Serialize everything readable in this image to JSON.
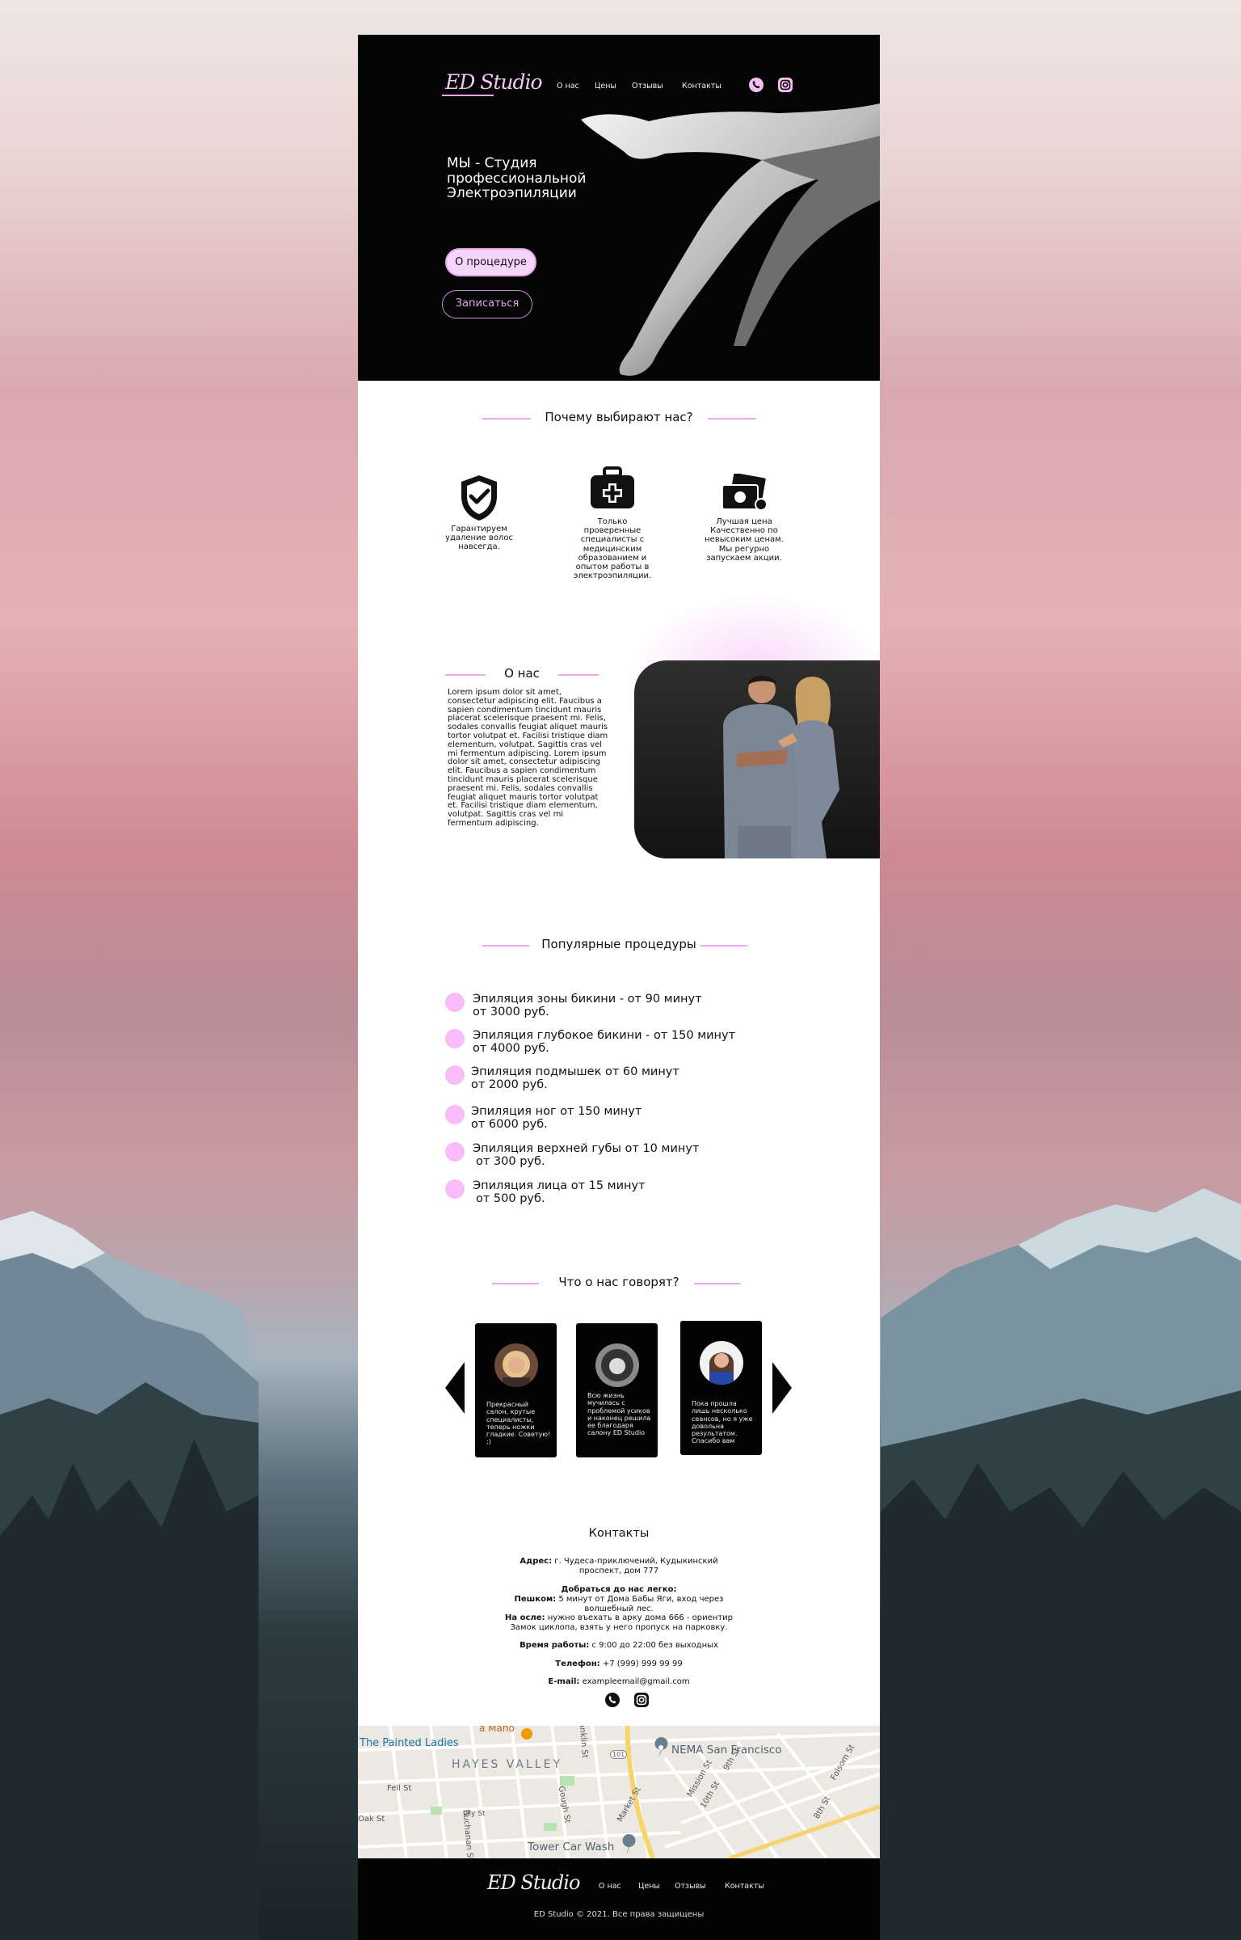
{
  "header": {
    "logo": "ED Studio",
    "nav": [
      "О нас",
      "Цены",
      "Отзывы",
      "Контакты"
    ],
    "social_icons": [
      "whatsapp-icon",
      "instagram-icon"
    ]
  },
  "hero": {
    "title_line1": "МЫ - Студия",
    "title_line2": "профессиональной",
    "title_line3": "Электроэпиляции",
    "btn_procedure": "О процедуре",
    "btn_signup": "Записаться"
  },
  "why": {
    "title": "Почему выбирают нас?",
    "items": [
      {
        "icon": "shield-check-icon",
        "text": "Гарантируем удаление волос навсегда."
      },
      {
        "icon": "medical-kit-icon",
        "text": "Только проверенные специалисты с медицинским образованием и опытом работы в электроэпиляции."
      },
      {
        "icon": "money-icon",
        "text": "Лучшая цена Качественно по невысоким ценам. Мы регурно запускаем акции."
      }
    ]
  },
  "about": {
    "title": "О нас",
    "text": "Lorem ipsum dolor sit amet, consectetur adipiscing elit. Faucibus a sapien condimentum tincidunt mauris placerat scelerisque praesent mi. Felis, sodales convallis feugiat aliquet mauris tortor volutpat et. Facilisi tristique diam elementum, volutpat. Sagittis cras vel mi fermentum adipiscing. Lorem ipsum dolor sit amet, consectetur adipiscing elit. Faucibus a sapien condimentum tincidunt mauris placerat scelerisque praesent mi. Felis, sodales convallis feugiat aliquet mauris tortor volutpat et. Facilisi tristique diam elementum, volutpat. Sagittis cras vel mi fermentum adipiscing."
  },
  "procedures": {
    "title": "Популярные процедуры",
    "items": [
      {
        "line1": "Эпиляция зоны бикини  - от 90 минут",
        "line2": "от 3000 руб."
      },
      {
        "line1": "Эпиляция глубокое бикини - от 150 минут",
        "line2": "от 4000 руб."
      },
      {
        "line1": "Эпиляция подмышек от 60 минут",
        "line2": "от 2000 руб."
      },
      {
        "line1": "Эпиляция ног от 150 минут",
        "line2": "от 6000 руб."
      },
      {
        "line1": "Эпиляция верхней губы от 10 минут",
        "line2": "от 300 руб."
      },
      {
        "line1": "Эпиляция лица от 15 минут",
        "line2": "от 500 руб."
      }
    ]
  },
  "reviews": {
    "title": "Что о нас говорят?",
    "items": [
      {
        "text": "Прекрасный салон, крутые специалисты, теперь ножки гладкие. Советую! ;)"
      },
      {
        "text": "Всю жизнь мучилась с проблемой усиков и наконец решила ее благодаря салону ED Studio"
      },
      {
        "text": "Пока прошла лишь несколько сеансов, но я уже довольна результатом. Спасибо вам"
      }
    ]
  },
  "contacts": {
    "title": "Контакты",
    "address_label": "Адрес:",
    "address_line1": "г. Чудеса-приключений, Кудыкинский",
    "address_line2": "проспект, дом 777",
    "route_label": "Добраться до нас легко:",
    "walk_label": "Пешком:",
    "walk_text": "5 минут от Дома Бабы Яги, вход через",
    "walk_text2": "волшебный лес.",
    "donkey_label": "На осле:",
    "donkey_text": "нужно въехать в арку дома 666 - ориентир",
    "donkey_text2": "Замок циклопа, взять у него пропуск на парковку.",
    "hours_label": "Время работы:",
    "hours": "с 9:00 до 22:00 без выходных",
    "phone_label": "Телефон:",
    "phone": "+7 (999) 999 99 99",
    "email_label": "E-mail:",
    "email": "exampleemail@gmail.com"
  },
  "map": {
    "labels": [
      "a Mano",
      "The Painted Ladies",
      "HAYES VALLEY",
      "NEMA San Francisco",
      "Tower Car Wash",
      "Fell St",
      "Oak St",
      "Lily St",
      "Market St",
      "Mission St",
      "10th St",
      "9th St",
      "8th St",
      "Folsom St",
      "Gough St",
      "101",
      "Franklin St",
      "Buchanan St"
    ]
  },
  "footer": {
    "logo": "ED Studio",
    "nav": [
      "О нас",
      "Цены",
      "Отзывы",
      "Контакты"
    ],
    "copyright": "ED Studio © 2021. Все права защищены"
  },
  "colors": {
    "accent": "#f6d5fb",
    "accent_line": "#f1a6f3",
    "dark": "#040404"
  }
}
